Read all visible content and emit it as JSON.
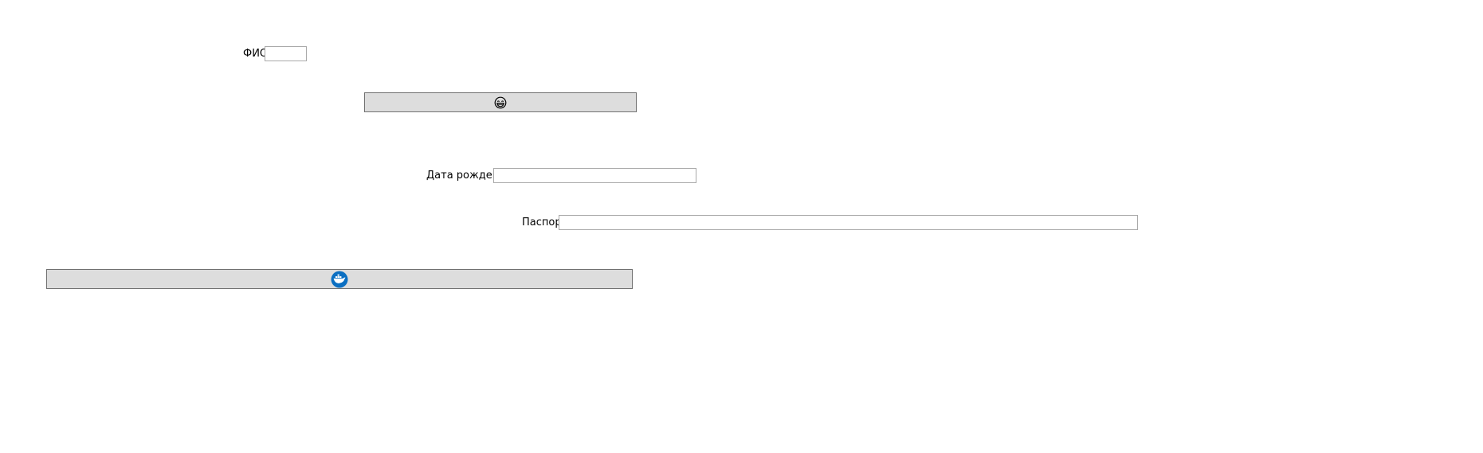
{
  "fields": {
    "fio": {
      "label": "ФИО",
      "value": "",
      "placeholder": ""
    },
    "birth_date": {
      "label": "Дата рождения",
      "value": "",
      "placeholder": ""
    },
    "passport": {
      "label": "Паспорт",
      "value": "",
      "placeholder": ""
    }
  },
  "buttons": {
    "emoji_button": {
      "icon": "grinning-face-icon",
      "color": "#000000"
    },
    "docker_button": {
      "icon": "docker-whale-icon",
      "color": "#0b6fc2"
    }
  },
  "colors": {
    "button_background": "#dddddd",
    "button_border": "#707070",
    "field_border": "#a9a9a9"
  }
}
